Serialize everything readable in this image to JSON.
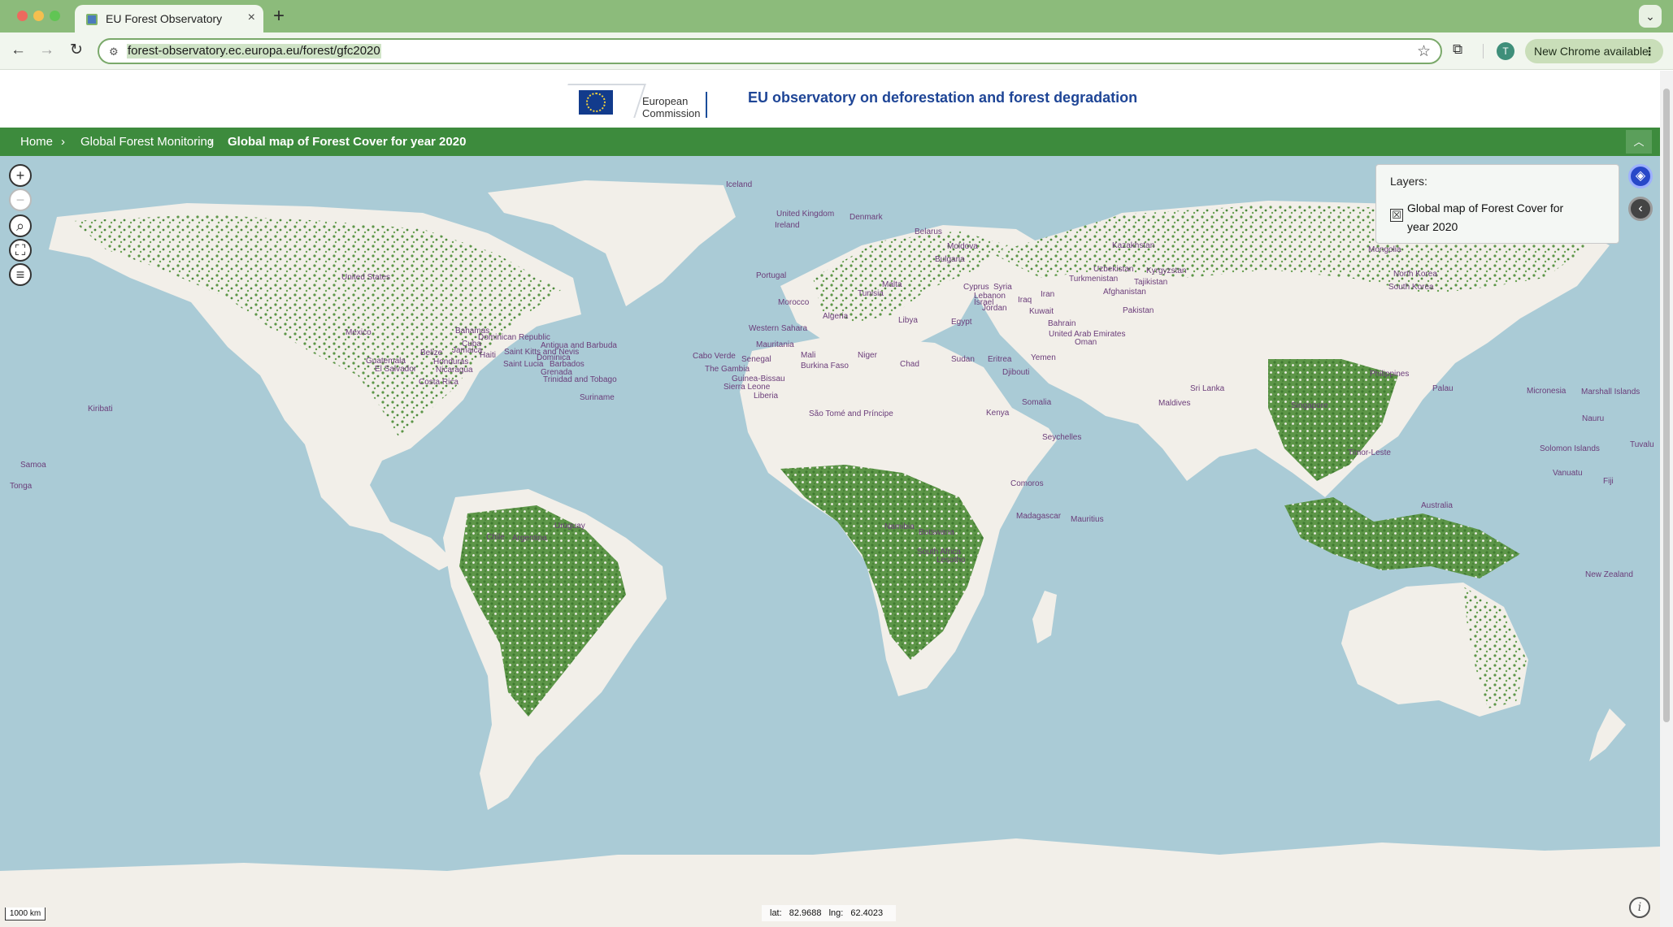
{
  "browser": {
    "tab_title": "EU Forest Observatory",
    "tab_close": "×",
    "new_tab": "+",
    "tab_menu": "⌄",
    "url": "forest-observatory.ec.europa.eu/forest/gfc2020",
    "profile_initial": "T",
    "update_label": "New Chrome available",
    "update_menu": "⋮",
    "nav_back": "←",
    "nav_forward": "→",
    "reload": "↻",
    "bookmark": "☆",
    "extensions": "⧉"
  },
  "header": {
    "logo_text_line1": "European",
    "logo_text_line2": "Commission",
    "site_title": "EU observatory on deforestation and forest degradation"
  },
  "breadcrumb": {
    "home": "Home",
    "section": "Global Forest Monitoring",
    "current": "Global map of Forest Cover for year 2020",
    "separator": "›",
    "collapse": "︿"
  },
  "map": {
    "controls": {
      "zoom_in": "+",
      "zoom_out": "−",
      "search": "⌕",
      "fullscreen": "⛶",
      "legend": "≡"
    },
    "layers_panel": {
      "title": "Layers:",
      "layer_name": "Global map of Forest Cover for year 2020",
      "layer_checked": true,
      "check_symbol": "☒"
    },
    "side_buttons": {
      "layers": "◈",
      "collapse": "‹"
    },
    "scale": "1000 km",
    "coords": {
      "lat_label": "lat:",
      "lat": "82.9688",
      "lng_label": "lng:",
      "lng": "62.4023"
    },
    "info": "i",
    "colors": {
      "ocean": "#aacbd6",
      "land": "#f2efe9",
      "forest": "#4d8a3c"
    },
    "place_labels": [
      "Iceland",
      "United Kingdom",
      "Ireland",
      "Denmark",
      "Belarus",
      "Moldova",
      "Bulgaria",
      "Portugal",
      "Tunisia",
      "Malta",
      "Morocco",
      "Algeria",
      "Libya",
      "Egypt",
      "Western Sahara",
      "Mauritania",
      "Mali",
      "Niger",
      "Chad",
      "Sudan",
      "Eritrea",
      "Yemen",
      "Djibouti",
      "Cabo Verde",
      "Senegal",
      "The Gambia",
      "Guinea-Bissau",
      "Sierra Leone",
      "Liberia",
      "Burkina Faso",
      "São Tomé and Príncipe",
      "Kenya",
      "Somalia",
      "Seychelles",
      "Comoros",
      "Madagascar",
      "Mauritius",
      "Namibia",
      "Botswana",
      "South Africa",
      "Lesotho",
      "Kazakhstan",
      "Uzbekistan",
      "Kyrgyzstan",
      "Turkmenistan",
      "Tajikistan",
      "Afghanistan",
      "Pakistan",
      "Iran",
      "Iraq",
      "Kuwait",
      "Bahrain",
      "United Arab Emirates",
      "Oman",
      "Cyprus",
      "Syria",
      "Lebanon",
      "Israel",
      "Jordan",
      "Mongolia",
      "North Korea",
      "South Korea",
      "Philippines",
      "Maldives",
      "Sri Lanka",
      "Singapore",
      "Timor-Leste",
      "Palau",
      "Micronesia",
      "Marshall Islands",
      "Nauru",
      "Solomon Islands",
      "Vanuatu",
      "Fiji",
      "Tuvalu",
      "Australia",
      "New Zealand",
      "United States",
      "Mexico",
      "Bahamas",
      "Cuba",
      "Dominican Republic",
      "Jamaica",
      "Haiti",
      "Belize",
      "Honduras",
      "Guatemala",
      "El Salvador",
      "Nicaragua",
      "Costa Rica",
      "Saint Kitts and Nevis",
      "Antigua and Barbuda",
      "Dominica",
      "Saint Lucia",
      "Barbados",
      "Grenada",
      "Trinidad and Tobago",
      "Kiribati",
      "Samoa",
      "Tonga",
      "Chile",
      "Argentina",
      "Uruguay",
      "Suriname"
    ]
  }
}
